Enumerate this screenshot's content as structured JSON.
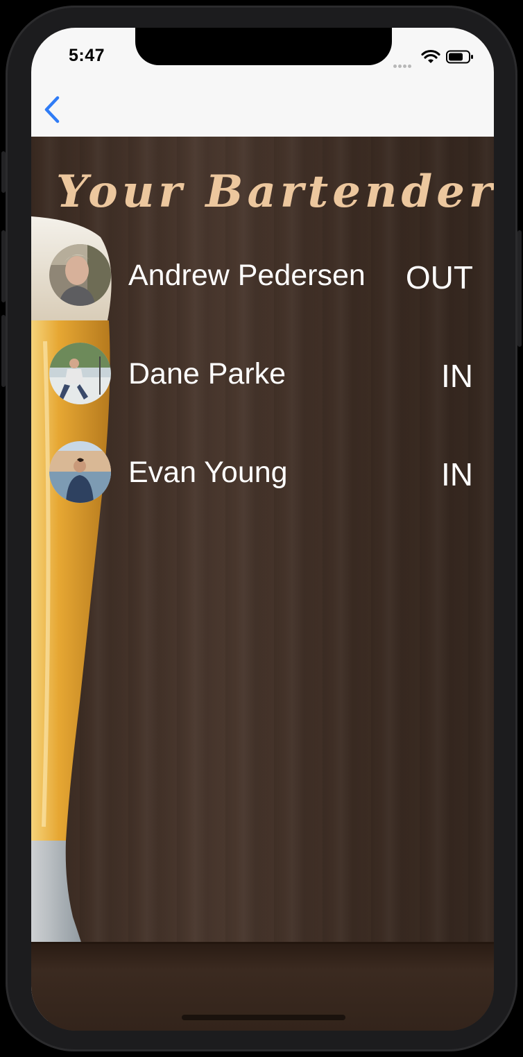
{
  "status_bar": {
    "time": "5:47",
    "icons": [
      "cellular-signal-icon",
      "wifi-icon",
      "battery-icon"
    ]
  },
  "nav": {
    "back_icon": "chevron-left-icon"
  },
  "page": {
    "title": "Your Bartenders",
    "title_color": "#ecc79e"
  },
  "bartenders": [
    {
      "name": "Andrew Pedersen",
      "status": "OUT"
    },
    {
      "name": "Dane Parke",
      "status": "IN"
    },
    {
      "name": "Evan Young",
      "status": "IN"
    }
  ],
  "colors": {
    "accent": "#2f7cf6",
    "nav_background": "#f7f7f7",
    "text": "#ffffff",
    "wood": "#3b2b22"
  }
}
